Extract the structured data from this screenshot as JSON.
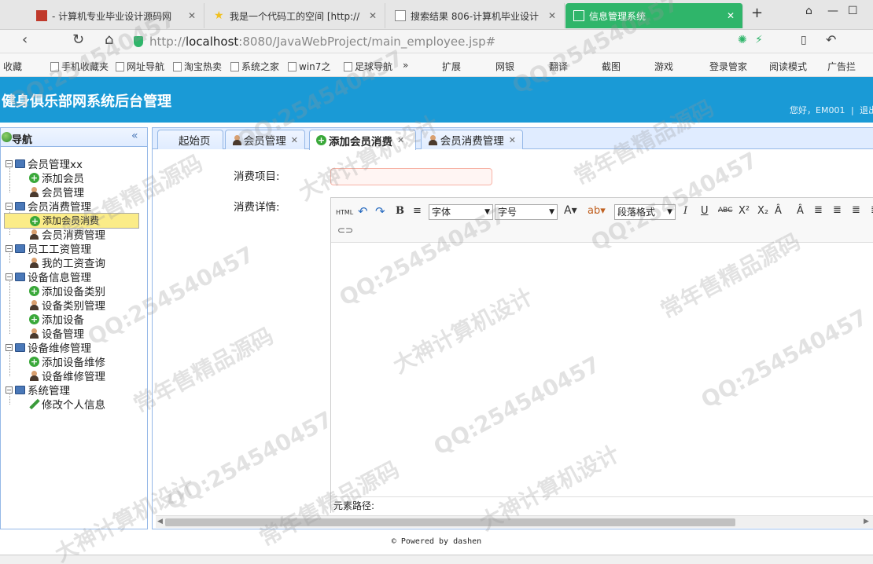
{
  "browser": {
    "tabs": [
      {
        "label": "- 计算机专业毕业设计源码网",
        "color": "#c0392b"
      },
      {
        "label": "我是一个代码工的空间 [http://",
        "color": "#f0c020"
      },
      {
        "label": "搜索结果 806-计算机毕业设计",
        "color": "#888888"
      },
      {
        "label": "信息管理系统",
        "color": "#ffffff"
      }
    ],
    "new_tab": "+",
    "url_host": "localhost",
    "url_rest": ":8080/JavaWebProject/main_employee.jsp#",
    "url_prefix": "http://",
    "bookmarks": [
      "收藏",
      "手机收藏夹",
      "网址导航",
      "淘宝热卖",
      "系统之家",
      "win7之",
      "足球导航",
      "»",
      "扩展",
      "网银",
      "翻译",
      "截图",
      "游戏",
      "登录管家",
      "阅读模式",
      "广告拦"
    ]
  },
  "header": {
    "title": "健身俱乐部网系统后台管理",
    "greeting": "您好，EM001",
    "sep": "|",
    "logout": "退出"
  },
  "nav": {
    "title": "导航",
    "collapse": "«",
    "items": [
      {
        "label": "会员管理xx",
        "type": "folder"
      },
      {
        "label": "添加会员",
        "type": "add"
      },
      {
        "label": "会员管理",
        "type": "user"
      },
      {
        "label": "会员消费管理",
        "type": "folder"
      },
      {
        "label": "添加会员消费",
        "type": "add",
        "selected": true
      },
      {
        "label": "会员消费管理",
        "type": "user"
      },
      {
        "label": "员工工资管理",
        "type": "folder"
      },
      {
        "label": "我的工资查询",
        "type": "user"
      },
      {
        "label": "设备信息管理",
        "type": "folder"
      },
      {
        "label": "添加设备类别",
        "type": "add"
      },
      {
        "label": "设备类别管理",
        "type": "user"
      },
      {
        "label": "添加设备",
        "type": "add"
      },
      {
        "label": "设备管理",
        "type": "user"
      },
      {
        "label": "设备维修管理",
        "type": "folder"
      },
      {
        "label": "添加设备维修",
        "type": "add"
      },
      {
        "label": "设备维修管理",
        "type": "user"
      },
      {
        "label": "系统管理",
        "type": "folder"
      },
      {
        "label": "修改个人信息",
        "type": "pencil"
      }
    ]
  },
  "tabs": [
    {
      "label": "起始页",
      "closable": false
    },
    {
      "label": "会员管理",
      "closable": true
    },
    {
      "label": "添加会员消费",
      "closable": true,
      "active": true
    },
    {
      "label": "会员消费管理",
      "closable": true
    }
  ],
  "form": {
    "item_label": "消费项目:",
    "item_value": "",
    "detail_label": "消费详情:"
  },
  "editor": {
    "html_btn": "HTML",
    "font_select": "字体",
    "size_select": "字号",
    "para_select": "段落格式",
    "path_label": "元素路径:"
  },
  "footer": {
    "text": "© Powered by dashen"
  },
  "watermarks": [
    "QQ:254540457",
    "大神计算机设计",
    "常年售精品源码"
  ]
}
